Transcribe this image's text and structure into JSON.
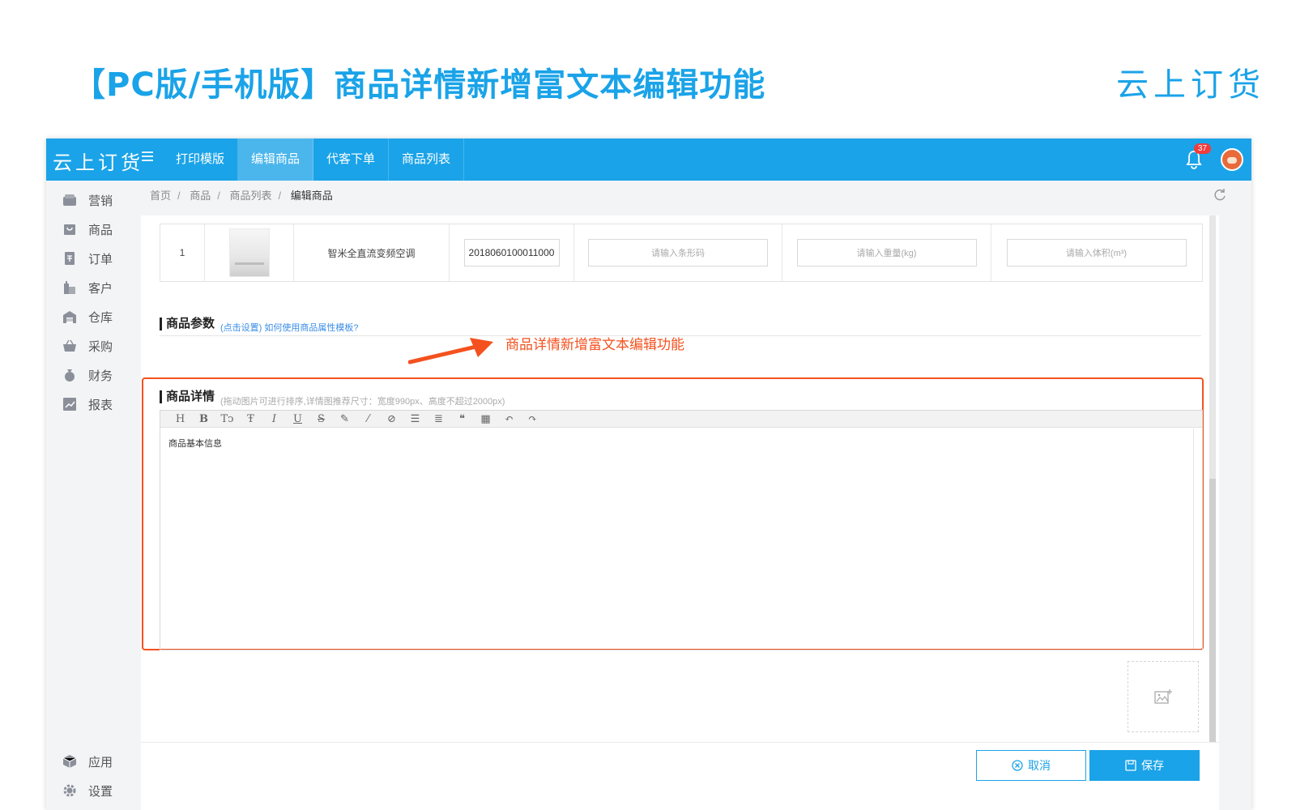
{
  "slide": {
    "title": "【PC版/手机版】商品详情新增富文本编辑功能",
    "brand": "云上订货"
  },
  "app": {
    "logo": "云上订货",
    "tabs": [
      "打印模版",
      "编辑商品",
      "代客下单",
      "商品列表"
    ],
    "active_tab": "编辑商品",
    "notification_count": "37"
  },
  "sidebar": {
    "items": [
      {
        "label": "营销",
        "icon": "store-icon"
      },
      {
        "label": "商品",
        "icon": "bag-icon"
      },
      {
        "label": "订单",
        "icon": "order-icon"
      },
      {
        "label": "客户",
        "icon": "building-icon"
      },
      {
        "label": "仓库",
        "icon": "warehouse-icon"
      },
      {
        "label": "采购",
        "icon": "basket-icon"
      },
      {
        "label": "财务",
        "icon": "moneybag-icon"
      },
      {
        "label": "报表",
        "icon": "chart-icon"
      }
    ],
    "bottom_items": [
      {
        "label": "应用",
        "icon": "cube-icon"
      },
      {
        "label": "设置",
        "icon": "gear-icon"
      }
    ]
  },
  "breadcrumb": [
    "首页",
    "商品",
    "商品列表",
    "编辑商品"
  ],
  "sku": {
    "index": "1",
    "name": "智米全直流变频空调",
    "code": "2018060100011000",
    "barcode_placeholder": "请输入条形码",
    "weight_placeholder": "请输入重量(kg)",
    "volume_placeholder": "请输入体积(m³)"
  },
  "params": {
    "title": "商品参数",
    "note": "(点击设置) 如何使用商品属性模板?"
  },
  "annotation": "商品详情新增富文本编辑功能",
  "details": {
    "title": "商品详情",
    "note": "(拖动图片可进行排序,详情图推荐尺寸：宽度990px、高度不超过2000px)",
    "toolbar": [
      "H",
      "B",
      "Tↄ",
      "Ŧ",
      "I",
      "U",
      "S",
      "✎",
      "⁄",
      "⊘",
      "☰",
      "≣",
      "❝",
      "▦",
      "↶",
      "↷"
    ],
    "body": "商品基本信息"
  },
  "actions": {
    "cancel": "取消",
    "save": "保存"
  },
  "colors": {
    "primary": "#1aa3e8",
    "annotation": "#f4511e",
    "badge": "#f23c3c"
  }
}
